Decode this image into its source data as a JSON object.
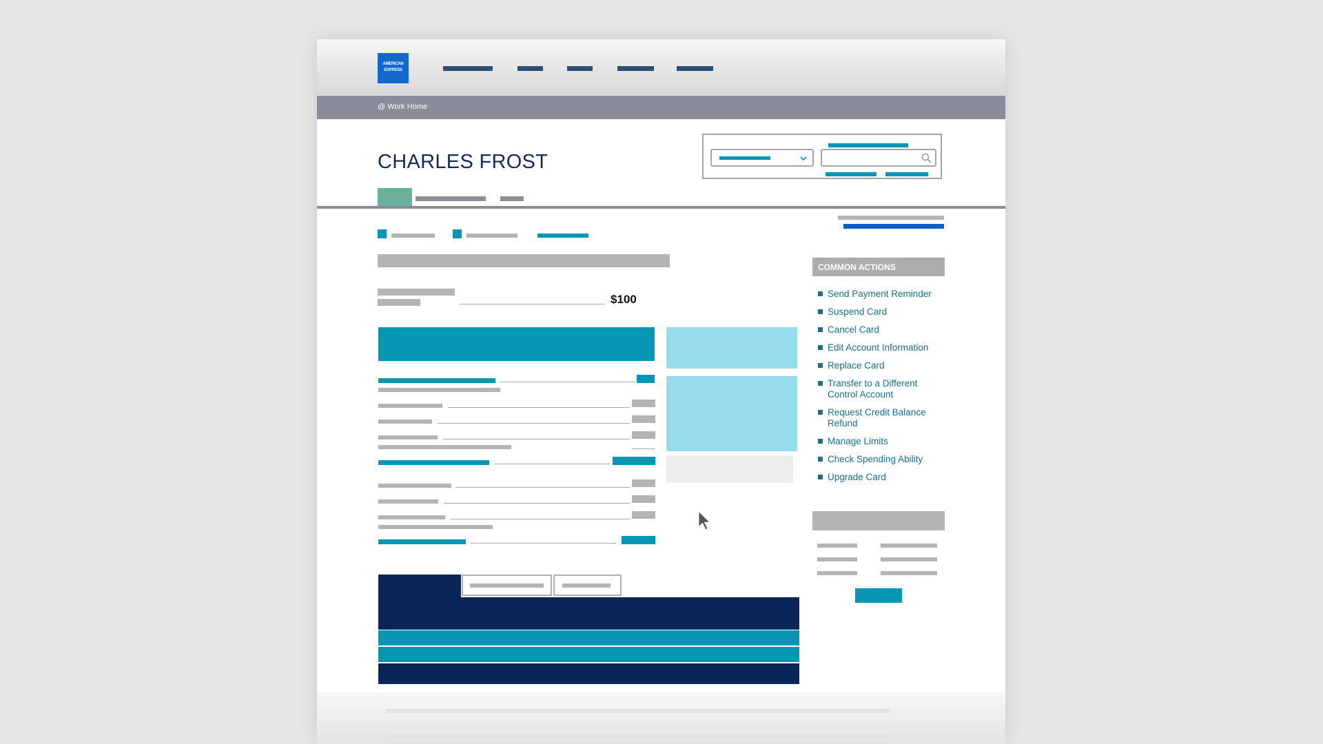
{
  "brand": {
    "logo_line1": "AMERICAN",
    "logo_line2": "EXPRESS",
    "color": "#1368ce"
  },
  "breadcrumb": {
    "label": "@ Work Home"
  },
  "account": {
    "name": "CHARLES FROST",
    "balance_amount": "$100"
  },
  "common_actions": {
    "heading": "COMMON ACTIONS",
    "items": [
      "Send Payment Reminder",
      "Suspend Card",
      "Cancel Card",
      "Edit Account Information",
      "Replace Card",
      "Transfer to a Different Control Account",
      "Request Credit Balance Refund",
      "Manage Limits",
      "Check Spending Ability",
      "Upgrade Card"
    ]
  },
  "icons": {
    "search": "search-icon",
    "dropdown": "chevron-down-icon",
    "cursor": "pointer-cursor-icon"
  },
  "colors": {
    "accent": "#0896b5",
    "navy": "#0a2558",
    "light_blue": "#97dcec",
    "nav": "#2e4f75",
    "link": "#16708e"
  }
}
